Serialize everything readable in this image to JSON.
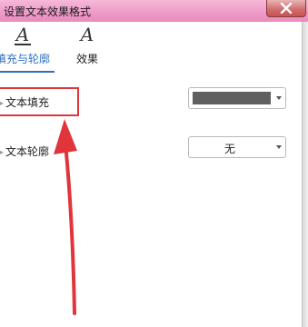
{
  "window": {
    "title": "设置文本效果格式"
  },
  "tabs": [
    {
      "label": "填充与轮廓",
      "active": true
    },
    {
      "label": "效果",
      "active": false
    }
  ],
  "sections": {
    "text_fill": {
      "label": "文本填充",
      "dropdown_color": "#606060"
    },
    "text_outline": {
      "label": "文本轮廓",
      "dropdown_value": "无"
    }
  },
  "colors": {
    "title_bar": "#ef9cc8",
    "accent": "#2f6fbf",
    "annotation": "#e0353a"
  }
}
